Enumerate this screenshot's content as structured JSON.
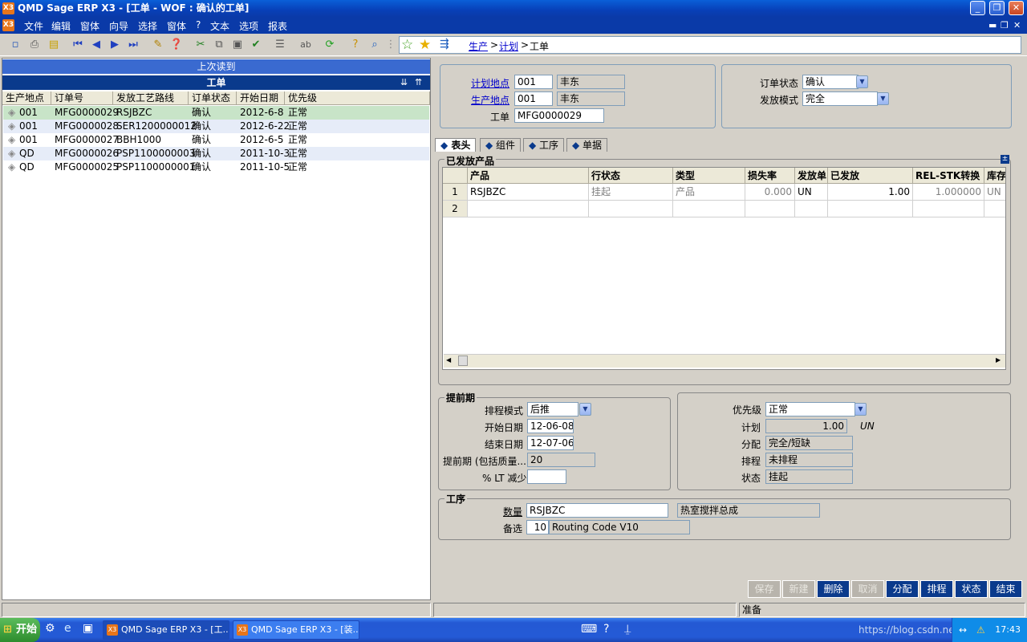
{
  "window": {
    "title": "QMD Sage ERP X3 - [工单 - WOF : 确认的工单]",
    "app_icon": "X3"
  },
  "menu": [
    "文件",
    "编辑",
    "窗体",
    "向导",
    "选择",
    "窗体",
    "?",
    "文本",
    "选项",
    "报表"
  ],
  "breadcrumb": {
    "items": [
      "生产",
      "计划"
    ],
    "current": "工单",
    "sep": ">"
  },
  "left": {
    "section_top": "上次读到",
    "section": "工单",
    "columns": [
      "生产地点",
      "订单号",
      "发放工艺路线",
      "订单状态",
      "开始日期",
      "优先级"
    ],
    "rows": [
      {
        "site": "001",
        "order": "MFG0000029",
        "route": "RSJBZC",
        "status": "确认",
        "start": "2012-6-8",
        "prio": "正常"
      },
      {
        "site": "001",
        "order": "MFG0000028",
        "route": "SER1200000012",
        "status": "确认",
        "start": "2012-6-22",
        "prio": "正常"
      },
      {
        "site": "001",
        "order": "MFG0000027",
        "route": "BBH1000",
        "status": "确认",
        "start": "2012-6-5",
        "prio": "正常"
      },
      {
        "site": "QD",
        "order": "MFG0000026",
        "route": "PSP1100000003",
        "status": "确认",
        "start": "2011-10-3",
        "prio": "正常"
      },
      {
        "site": "QD",
        "order": "MFG0000025",
        "route": "PSP1100000001",
        "status": "确认",
        "start": "2011-10-5",
        "prio": "正常"
      }
    ]
  },
  "header": {
    "plan_site_label": "计划地点",
    "plan_site": "001",
    "plan_site_name": "丰东",
    "prod_site_label": "生产地点",
    "prod_site": "001",
    "prod_site_name": "丰东",
    "wo_label": "工单",
    "wo": "MFG0000029",
    "order_status_label": "订单状态",
    "order_status": "确认",
    "release_mode_label": "发放模式",
    "release_mode": "完全"
  },
  "tabs": [
    "表头",
    "组件",
    "工序",
    "单据"
  ],
  "released": {
    "title": "已发放产品",
    "columns": [
      "产品",
      "行状态",
      "类型",
      "损失率",
      "发放单",
      "已发放",
      "REL-STK转换",
      "库存"
    ],
    "rows": [
      {
        "no": "1",
        "product": "RSJBZC",
        "line_status": "挂起",
        "type": "产品",
        "loss": "0.000",
        "unit": "UN",
        "released": "1.00",
        "conv": "1.000000",
        "stock_unit": "UN"
      },
      {
        "no": "2",
        "product": "",
        "line_status": "",
        "type": "",
        "loss": "",
        "unit": "",
        "released": "",
        "conv": "",
        "stock_unit": ""
      }
    ]
  },
  "lead": {
    "title": "提前期",
    "sched_mode_label": "排程模式",
    "sched_mode": "后推",
    "start_label": "开始日期",
    "start": "12-06-08",
    "end_label": "结束日期",
    "end": "12-07-06",
    "leadtime_label": "提前期 (包括质量...",
    "leadtime": "20",
    "lt_reduce_label": "% LT 减少",
    "lt_reduce": ""
  },
  "status": {
    "priority_label": "优先级",
    "priority": "正常",
    "plan_label": "计划",
    "plan": "1.00",
    "plan_unit": "UN",
    "alloc_label": "分配",
    "alloc": "完全/短缺",
    "sched_label": "排程",
    "sched": "未排程",
    "state_label": "状态",
    "state": "挂起"
  },
  "routing": {
    "title": "工序",
    "qty_label": "数量",
    "qty": "RSJBZC",
    "qty_desc": "热室搅拌总成",
    "alt_label": "备选",
    "alt": "10",
    "alt_desc": "Routing Code V10"
  },
  "actions": [
    {
      "label": "保存",
      "enabled": false
    },
    {
      "label": "新建",
      "enabled": false
    },
    {
      "label": "删除",
      "enabled": true
    },
    {
      "label": "取消",
      "enabled": false
    },
    {
      "label": "分配",
      "enabled": true
    },
    {
      "label": "排程",
      "enabled": true
    },
    {
      "label": "状态",
      "enabled": true
    },
    {
      "label": "结束",
      "enabled": true
    }
  ],
  "statusbar": {
    "text": "准备"
  },
  "taskbar": {
    "start": "开始",
    "tasks": [
      "QMD Sage ERP X3 - [工...",
      "QMD Sage ERP X3 - [装..."
    ],
    "clock": "17:43",
    "watermark": "https://blog.csdn.net/dbyst"
  }
}
